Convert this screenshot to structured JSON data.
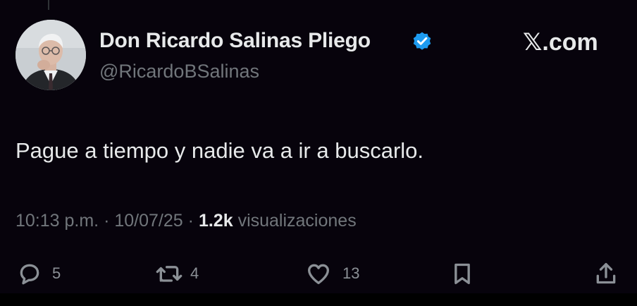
{
  "author": {
    "display_name": "Don Ricardo Salinas Pliego",
    "handle": "@RicardoBSalinas",
    "verified": true,
    "verified_color": "#1d9bf0"
  },
  "brand": {
    "label": "𝕏.com"
  },
  "tweet": {
    "text": "Pague a tiempo y nadie va a ir a buscarlo."
  },
  "meta": {
    "time": "10:13 p.m.",
    "separator": "·",
    "date": "10/07/25",
    "views_count": "1.2k",
    "views_label": "visualizaciones"
  },
  "actions": {
    "replies": "5",
    "retweets": "4",
    "likes": "13"
  },
  "icons": [
    "reply-icon",
    "retweet-icon",
    "like-icon",
    "bookmark-icon",
    "share-icon",
    "verified-badge-icon"
  ],
  "colors": {
    "background": "#07030c",
    "text": "#e7e9ea",
    "secondary_text": "#71767b"
  }
}
